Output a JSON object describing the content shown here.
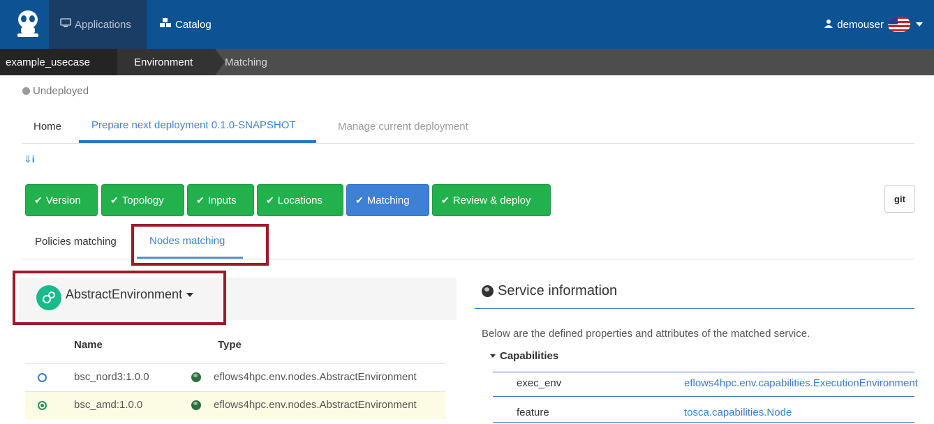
{
  "navbar": {
    "applications_label": "Applications",
    "catalog_label": "Catalog",
    "user_label": "demouser"
  },
  "breadcrumb": {
    "items": [
      "example_usecase",
      "Environment",
      "Matching"
    ]
  },
  "status": {
    "label": "Undeployed"
  },
  "main_tabs": {
    "home": "Home",
    "prepare": "Prepare next deployment 0.1.0-SNAPSHOT",
    "manage": "Manage current deployment"
  },
  "steps": [
    "Version",
    "Topology",
    "Inputs",
    "Locations",
    "Matching",
    "Review & deploy"
  ],
  "git_label": "git",
  "sub_tabs": {
    "policies": "Policies matching",
    "nodes": "Nodes matching"
  },
  "node": {
    "title": "AbstractEnvironment",
    "columns": {
      "name": "Name",
      "type": "Type"
    },
    "rows": [
      {
        "name": "bsc_nord3:1.0.0",
        "type": "eflows4hpc.env.nodes.AbstractEnvironment",
        "selected": false
      },
      {
        "name": "bsc_amd:1.0.0",
        "type": "eflows4hpc.env.nodes.AbstractEnvironment",
        "selected": true
      }
    ]
  },
  "service": {
    "title": "Service information",
    "description": "Below are the defined properties and attributes of the matched service.",
    "capabilities_label": "Capabilities",
    "capabilities": [
      {
        "key": "exec_env",
        "value": "eflows4hpc.env.capabilities.ExecutionEnvironment"
      },
      {
        "key": "feature",
        "value": "tosca.capabilities.Node"
      }
    ]
  },
  "colors": {
    "navbar": "#0d5394",
    "step_done": "#22b14c",
    "step_active": "#3e80d6",
    "highlight_box": "#a0192a",
    "link": "#3b84d6"
  }
}
